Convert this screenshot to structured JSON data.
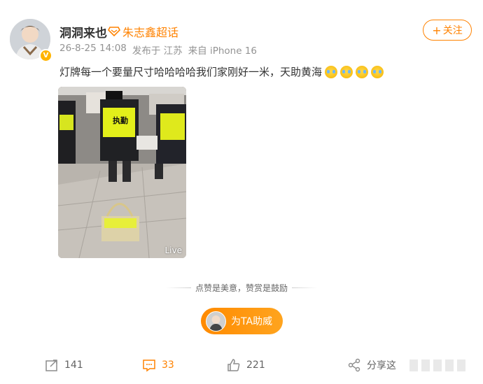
{
  "post": {
    "username": "洞洞来也",
    "topic": "朱志鑫超话",
    "time": "26-8-25 14:08",
    "published_from": "发布于 江苏",
    "device": "来自 iPhone 16",
    "follow_label": "关注",
    "text": "灯牌每一个要量尺寸哈哈哈哈我们家刚好一米，天助黄海",
    "emoji_count": 4,
    "image_tag": "Live"
  },
  "reward": {
    "hint": "点赞是美意，赞赏是鼓励",
    "cheer_label": "为TA助威"
  },
  "actions": {
    "repost": "141",
    "comment": "33",
    "like": "221",
    "share_label": "分享这"
  },
  "colors": {
    "accent": "#ff8200",
    "verified": "#ffb400"
  }
}
